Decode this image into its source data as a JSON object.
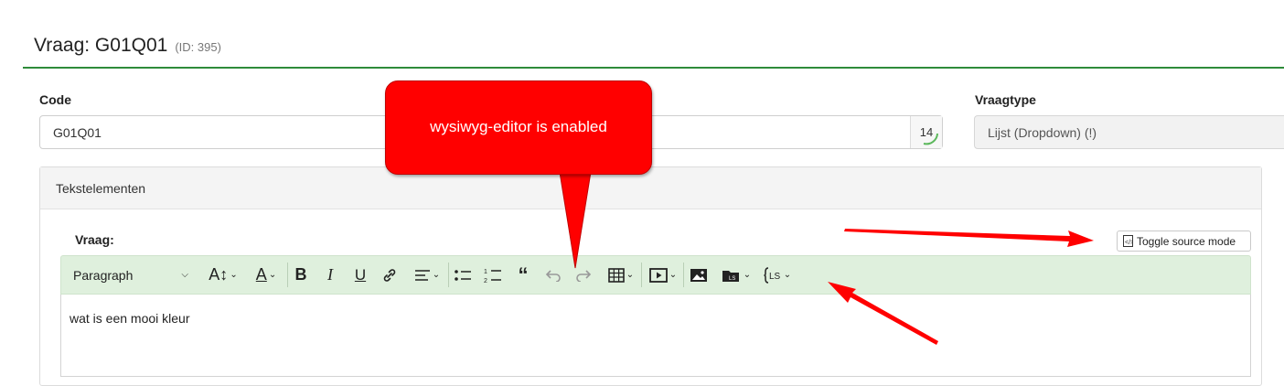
{
  "header": {
    "title": "Vraag: G01Q01",
    "id_label": "(ID: 395)"
  },
  "code": {
    "label": "Code",
    "value": "G01Q01",
    "char_count": "14"
  },
  "question_type": {
    "label": "Vraagtype",
    "value": "Lijst (Dropdown) (!)"
  },
  "panel": {
    "title": "Tekstelementen"
  },
  "question_field": {
    "label": "Vraag:"
  },
  "toolbar": {
    "paragraph": "Paragraph",
    "toggle_source": "Toggle source mode",
    "items": [
      "font-size-icon",
      "font-color-icon",
      "bold-icon",
      "italic-icon",
      "underline-icon",
      "link-icon",
      "align-icon",
      "bulleted-list-icon",
      "numbered-list-icon",
      "blockquote-icon",
      "undo-icon",
      "redo-icon",
      "table-icon",
      "media-embed-icon",
      "image-icon",
      "file-manager-icon",
      "expression-icon"
    ]
  },
  "editor": {
    "content": "wat is een mooi kleur"
  },
  "annotation": {
    "callout_text": "wysiwyg-editor is enabled",
    "color": "#ff0000"
  },
  "colors": {
    "accent": "#2e8b3a",
    "toolbar_bg": "#dff0dd"
  }
}
